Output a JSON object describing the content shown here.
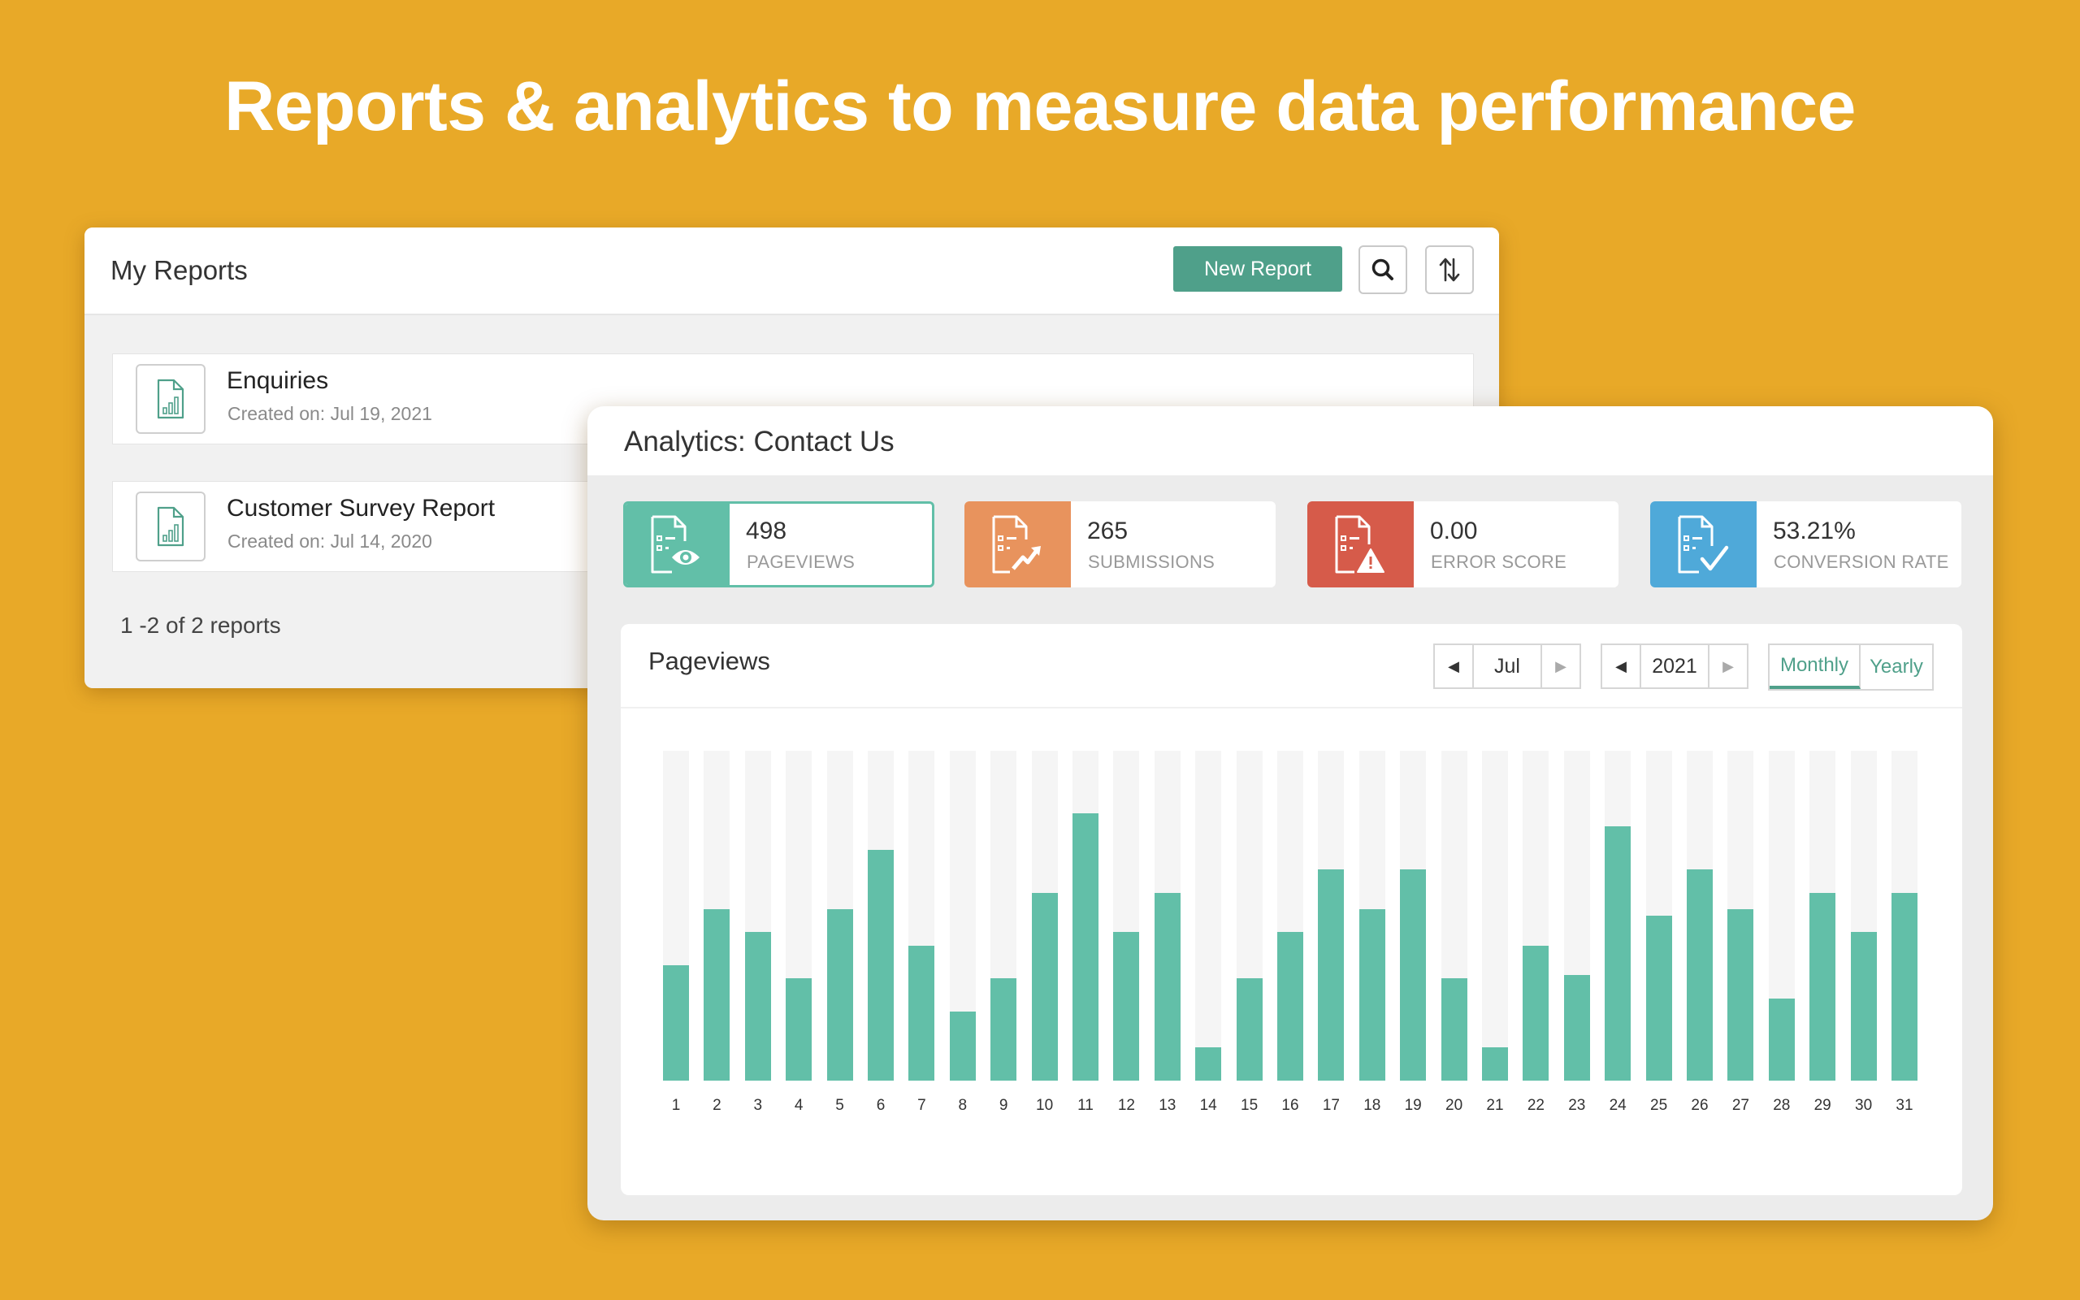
{
  "headline": "Reports & analytics to measure data performance",
  "colors": {
    "background": "#E8A928",
    "primary_green": "#4FA08A",
    "bar_green": "#62BFA8",
    "bar_track": "#f5f5f5",
    "pageviews": "#62BFA8",
    "submissions": "#E8935D",
    "error": "#D65B4A",
    "conversion": "#4FA9D9"
  },
  "my_reports": {
    "title": "My Reports",
    "new_report_label": "New Report",
    "search_icon": "search-icon",
    "sort_icon": "sort-arrows-icon",
    "reports": [
      {
        "name": "Enquiries",
        "created": "Created on: Jul 19, 2021",
        "icon": "report-chart-icon"
      },
      {
        "name": "Customer Survey Report",
        "created": "Created on: Jul 14, 2020",
        "icon": "report-chart-icon"
      }
    ],
    "count_text": "1 -2 of 2 reports"
  },
  "analytics": {
    "title": "Analytics: Contact Us",
    "stats": [
      {
        "value": "498",
        "label": "PAGEVIEWS",
        "icon": "form-eye-icon",
        "color": "#62BFA8",
        "active": true
      },
      {
        "value": "265",
        "label": "SUBMISSIONS",
        "icon": "form-trend-icon",
        "color": "#E8935D",
        "active": false
      },
      {
        "value": "0.00",
        "label": "ERROR SCORE",
        "icon": "form-warning-icon",
        "color": "#D65B4A",
        "active": false
      },
      {
        "value": "53.21%",
        "label": "CONVERSION RATE",
        "icon": "form-check-icon",
        "color": "#4FA9D9",
        "active": false
      }
    ],
    "chart_header": {
      "title": "Pageviews",
      "month": "Jul",
      "year": "2021",
      "period_options": [
        "Monthly",
        "Yearly"
      ],
      "selected_period": "Monthly"
    }
  },
  "chart_data": {
    "type": "bar",
    "title": "Pageviews",
    "xlabel": "",
    "ylabel": "",
    "note": "No y-axis shown; values are relative bar heights as fraction of the full track (0-1).",
    "ylim": [
      0,
      1
    ],
    "grid": false,
    "categories": [
      "1",
      "2",
      "3",
      "4",
      "5",
      "6",
      "7",
      "8",
      "9",
      "10",
      "11",
      "12",
      "13",
      "14",
      "15",
      "16",
      "17",
      "18",
      "19",
      "20",
      "21",
      "22",
      "23",
      "24",
      "25",
      "26",
      "27",
      "28",
      "29",
      "30",
      "31"
    ],
    "values": [
      0.35,
      0.52,
      0.45,
      0.31,
      0.52,
      0.7,
      0.41,
      0.21,
      0.31,
      0.57,
      0.81,
      0.45,
      0.57,
      0.1,
      0.31,
      0.45,
      0.64,
      0.52,
      0.64,
      0.31,
      0.1,
      0.41,
      0.32,
      0.77,
      0.5,
      0.64,
      0.52,
      0.25,
      0.57,
      0.45,
      0.57
    ]
  }
}
